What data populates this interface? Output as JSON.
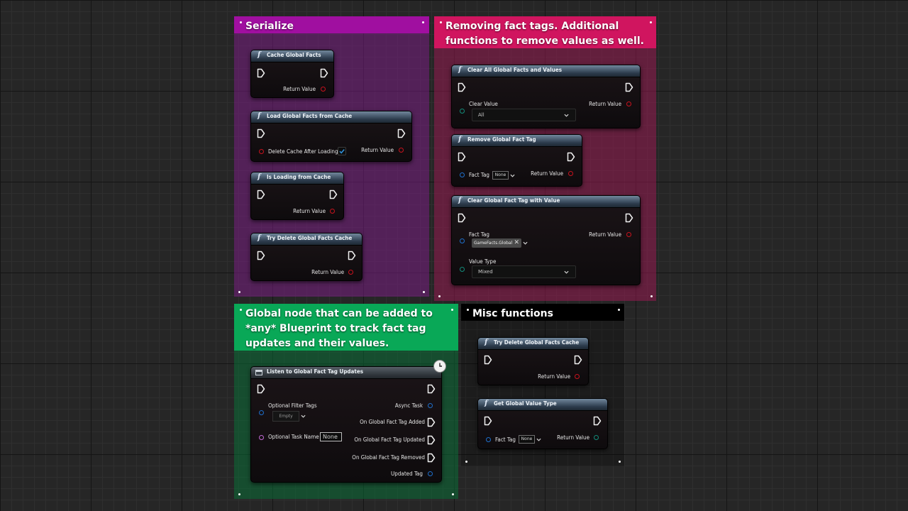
{
  "comments": {
    "serialize": {
      "title": "Serialize",
      "color": "#a00fa0",
      "body": "rgba(120,30,130,0.55)"
    },
    "removing": {
      "title": "Removing fact tags. Additional\nfunctions to remove values as well.",
      "color": "#d0155f",
      "body": "rgba(150,25,80,0.55)"
    },
    "global": {
      "title": "Global node that can be added to\n*any* Blueprint to track fact tag\nupdates and their values.",
      "color": "#09a857",
      "body": "rgba(10,110,55,0.55)"
    },
    "misc": {
      "title": "Misc functions",
      "color": "#000000",
      "body": "rgba(0,0,0,0.25)"
    }
  },
  "nodes": {
    "cache_global_facts": {
      "title": "Cache Global Facts",
      "return": "Return Value"
    },
    "load_from_cache": {
      "title": "Load Global Facts from Cache",
      "param": "Delete Cache After Loading",
      "return": "Return Value",
      "checked": true
    },
    "is_loading": {
      "title": "Is Loading from Cache",
      "return": "Return Value"
    },
    "try_delete_1": {
      "title": "Try Delete Global Facts Cache",
      "return": "Return Value"
    },
    "clear_all": {
      "title": "Clear All Global Facts and Values",
      "param": "Clear Value",
      "dropdown": "All",
      "return": "Return Value"
    },
    "remove_tag": {
      "title": "Remove Global Fact Tag",
      "param": "Fact Tag",
      "tag": "None",
      "return": "Return Value"
    },
    "clear_with_value": {
      "title": "Clear Global Fact Tag with Value",
      "param": "Fact Tag",
      "chip": "GameFacts.Global",
      "param2": "Value Type",
      "dropdown": "Mixed",
      "return": "Return Value"
    },
    "listen": {
      "title": "Listen to Global Fact Tag Updates",
      "filter_label": "Optional Filter Tags",
      "filter_value": "Empty",
      "task_label": "Optional Task Name",
      "task_value": "None",
      "outputs": [
        "Async Task",
        "On Global Fact Tag Added",
        "On Global Fact Tag Updated",
        "On Global Fact Tag Removed",
        "Updated Tag"
      ]
    },
    "try_delete_2": {
      "title": "Try Delete Global Facts Cache",
      "return": "Return Value"
    },
    "get_value_type": {
      "title": "Get Global Value Type",
      "param": "Fact Tag",
      "tag": "None",
      "return": "Return Value"
    }
  }
}
